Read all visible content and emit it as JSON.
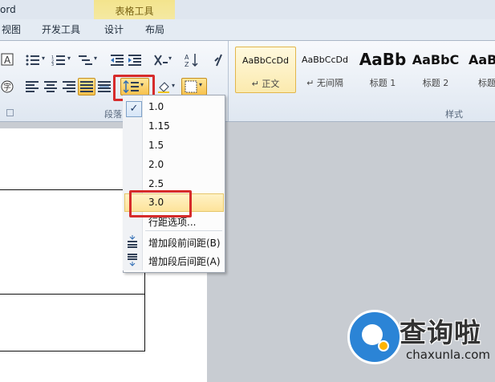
{
  "window": {
    "app_title": "ord"
  },
  "tabs": [
    "视图",
    "开发工具",
    "设计",
    "布局"
  ],
  "context_tab": {
    "label": "表格工具",
    "color": "#f5e79f"
  },
  "ribbon": {
    "paragraph_group_label": "段落",
    "styles_group_label": "样式",
    "styles": [
      {
        "sample": "AaBbCcDd",
        "name": "↵ 正文"
      },
      {
        "sample": "AaBbCcDd",
        "name": "↵ 无间隔"
      },
      {
        "sample": "AaBb",
        "name": "标题 1"
      },
      {
        "sample": "AaBbC",
        "name": "标题 2"
      },
      {
        "sample": "AaBl",
        "name": "标题"
      }
    ]
  },
  "line_spacing_menu": {
    "items": [
      {
        "label": "1.0",
        "checked": true
      },
      {
        "label": "1.15",
        "checked": false
      },
      {
        "label": "1.5",
        "checked": false
      },
      {
        "label": "2.0",
        "checked": false
      },
      {
        "label": "2.5",
        "checked": false
      },
      {
        "label": "3.0",
        "checked": false,
        "highlighted": true
      }
    ],
    "options_label": "行距选项...",
    "add_before_label": "增加段前间距(B)",
    "add_after_label": "增加段后间距(A)"
  },
  "watermark": {
    "title": "查询啦",
    "subtitle": "chaxunla.com"
  },
  "colors": {
    "accent_red": "#d62b2b",
    "highlight": "#fde39a",
    "watermark_blue": "#2b84d6"
  }
}
